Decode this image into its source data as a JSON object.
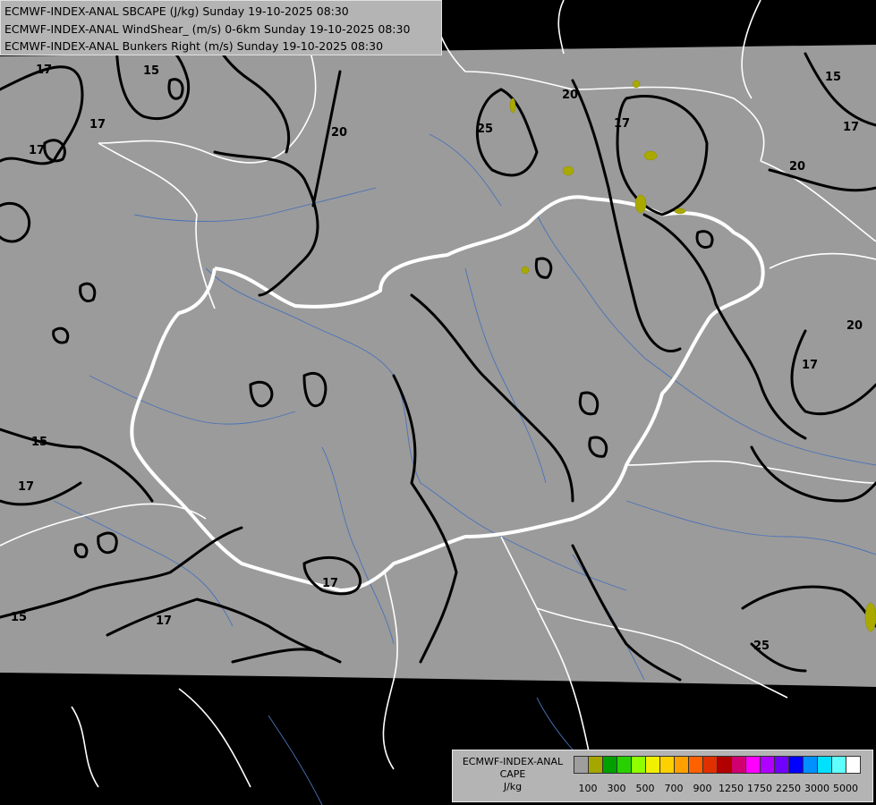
{
  "title_lines": [
    "ECMWF-INDEX-ANAL SBCAPE (J/kg) Sunday 19-10-2025 08:30",
    "ECMWF-INDEX-ANAL WindShear_ (m/s) 0-6km Sunday 19-10-2025 08:30",
    "ECMWF-INDEX-ANAL Bunkers Right (m/s) Sunday 19-10-2025 08:30"
  ],
  "legend": {
    "model": "ECMWF-INDEX-ANAL",
    "field": "CAPE",
    "unit": "J/kg",
    "colors": [
      "#9e9e9e",
      "#a6a600",
      "#00a000",
      "#28d000",
      "#90ff00",
      "#f0f000",
      "#ffd000",
      "#ffa000",
      "#ff6000",
      "#e03000",
      "#b00000",
      "#d00070",
      "#ff00ff",
      "#b000ff",
      "#7000ff",
      "#0000ff",
      "#0090ff",
      "#00e0ff",
      "#60ffff",
      "#ffffff"
    ],
    "tick_labels": [
      "100",
      "300",
      "500",
      "700",
      "900",
      "1250",
      "1750",
      "2250",
      "3000",
      "5000"
    ]
  },
  "contour_labels": [
    "17",
    "15",
    "17",
    "20",
    "25",
    "20",
    "17",
    "15",
    "20",
    "17",
    "20",
    "17",
    "15",
    "17",
    "17",
    "17",
    "17",
    "15",
    "25"
  ],
  "colors": {
    "background": "#9b9b9b",
    "outside": "#000000",
    "contour": "#000000",
    "border": "#ffffff",
    "river": "#4a72b8",
    "cape_low": "#a6a600"
  }
}
